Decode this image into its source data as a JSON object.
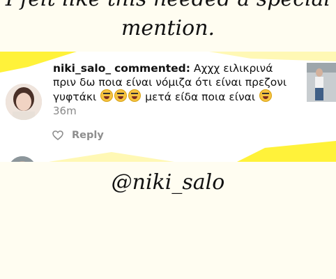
{
  "captions": {
    "top_line1": "I felt like this needed a special",
    "top_line2": "mention.",
    "bottom": "@niki_salo"
  },
  "comment": {
    "username": "niki_salo_",
    "action": "commented:",
    "text": "Αχχχ ειλικρινά πριν δω ποια είναι νόμιζα ότι είναι πρεζονι γυφτάκι",
    "text_after_emojis": "μετά είδα ποια είναι",
    "timestamp": "36m",
    "reply_label": "Reply",
    "emoji_count": 3
  },
  "colors": {
    "background": "#fffdf1",
    "card": "#ffffff",
    "accent_yellow": "#fff32b",
    "secondary_text": "#8e8e8e"
  },
  "icons": {
    "like": "heart-icon",
    "emoji": "laughing-tears-emoji-icon"
  }
}
